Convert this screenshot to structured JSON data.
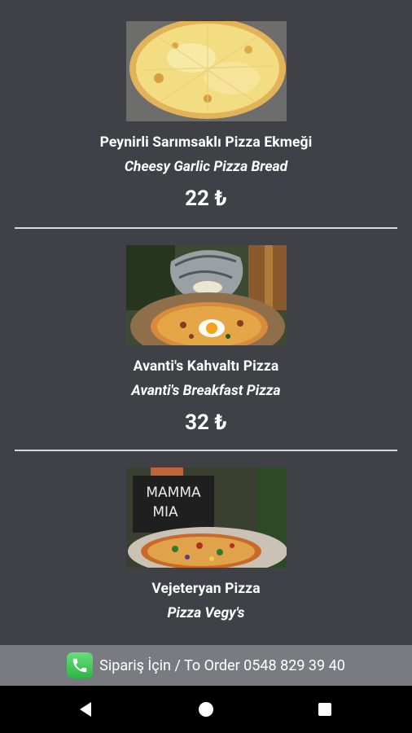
{
  "menu": {
    "items": [
      {
        "name_tr": "Peynirli Sarımsaklı Pizza Ekmeği",
        "name_en": "Cheesy Garlic Pizza Bread",
        "price": "22 ₺"
      },
      {
        "name_tr": "Avanti's Kahvaltı Pizza",
        "name_en": "Avanti's Breakfast Pizza",
        "price": "32 ₺"
      },
      {
        "name_tr": "Vejeteryan Pizza",
        "name_en": "Pizza Vegy's"
      }
    ],
    "photo3_sign": {
      "line1": "MAMMA",
      "line2": "MIA"
    }
  },
  "order_bar": {
    "text": "Sipariş İçin / To Order 0548 829 39 40",
    "icon": "phone-icon"
  },
  "nav": {
    "back": "back-icon",
    "home": "home-icon",
    "recents": "recents-icon"
  },
  "colors": {
    "background": "#404146",
    "order_bar": "#7a7b80",
    "divider": "#d9d9d9",
    "nav_bar": "#000000"
  }
}
